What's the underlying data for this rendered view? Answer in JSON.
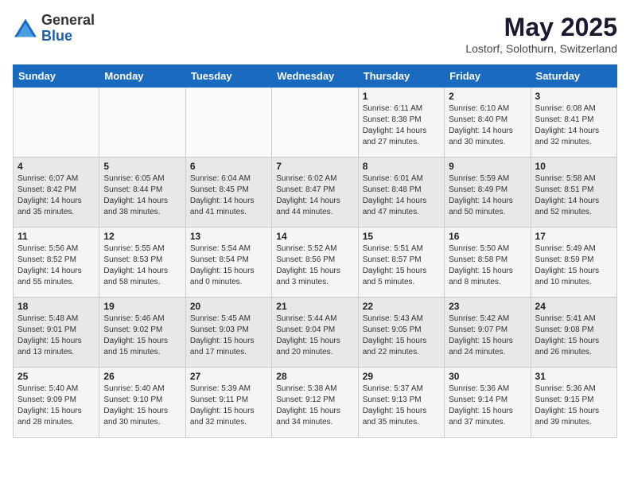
{
  "logo": {
    "general": "General",
    "blue": "Blue"
  },
  "title": "May 2025",
  "subtitle": "Lostorf, Solothurn, Switzerland",
  "days_header": [
    "Sunday",
    "Monday",
    "Tuesday",
    "Wednesday",
    "Thursday",
    "Friday",
    "Saturday"
  ],
  "weeks": [
    [
      {
        "day": "",
        "info": ""
      },
      {
        "day": "",
        "info": ""
      },
      {
        "day": "",
        "info": ""
      },
      {
        "day": "",
        "info": ""
      },
      {
        "day": "1",
        "info": "Sunrise: 6:11 AM\nSunset: 8:38 PM\nDaylight: 14 hours and 27 minutes."
      },
      {
        "day": "2",
        "info": "Sunrise: 6:10 AM\nSunset: 8:40 PM\nDaylight: 14 hours and 30 minutes."
      },
      {
        "day": "3",
        "info": "Sunrise: 6:08 AM\nSunset: 8:41 PM\nDaylight: 14 hours and 32 minutes."
      }
    ],
    [
      {
        "day": "4",
        "info": "Sunrise: 6:07 AM\nSunset: 8:42 PM\nDaylight: 14 hours and 35 minutes."
      },
      {
        "day": "5",
        "info": "Sunrise: 6:05 AM\nSunset: 8:44 PM\nDaylight: 14 hours and 38 minutes."
      },
      {
        "day": "6",
        "info": "Sunrise: 6:04 AM\nSunset: 8:45 PM\nDaylight: 14 hours and 41 minutes."
      },
      {
        "day": "7",
        "info": "Sunrise: 6:02 AM\nSunset: 8:47 PM\nDaylight: 14 hours and 44 minutes."
      },
      {
        "day": "8",
        "info": "Sunrise: 6:01 AM\nSunset: 8:48 PM\nDaylight: 14 hours and 47 minutes."
      },
      {
        "day": "9",
        "info": "Sunrise: 5:59 AM\nSunset: 8:49 PM\nDaylight: 14 hours and 50 minutes."
      },
      {
        "day": "10",
        "info": "Sunrise: 5:58 AM\nSunset: 8:51 PM\nDaylight: 14 hours and 52 minutes."
      }
    ],
    [
      {
        "day": "11",
        "info": "Sunrise: 5:56 AM\nSunset: 8:52 PM\nDaylight: 14 hours and 55 minutes."
      },
      {
        "day": "12",
        "info": "Sunrise: 5:55 AM\nSunset: 8:53 PM\nDaylight: 14 hours and 58 minutes."
      },
      {
        "day": "13",
        "info": "Sunrise: 5:54 AM\nSunset: 8:54 PM\nDaylight: 15 hours and 0 minutes."
      },
      {
        "day": "14",
        "info": "Sunrise: 5:52 AM\nSunset: 8:56 PM\nDaylight: 15 hours and 3 minutes."
      },
      {
        "day": "15",
        "info": "Sunrise: 5:51 AM\nSunset: 8:57 PM\nDaylight: 15 hours and 5 minutes."
      },
      {
        "day": "16",
        "info": "Sunrise: 5:50 AM\nSunset: 8:58 PM\nDaylight: 15 hours and 8 minutes."
      },
      {
        "day": "17",
        "info": "Sunrise: 5:49 AM\nSunset: 8:59 PM\nDaylight: 15 hours and 10 minutes."
      }
    ],
    [
      {
        "day": "18",
        "info": "Sunrise: 5:48 AM\nSunset: 9:01 PM\nDaylight: 15 hours and 13 minutes."
      },
      {
        "day": "19",
        "info": "Sunrise: 5:46 AM\nSunset: 9:02 PM\nDaylight: 15 hours and 15 minutes."
      },
      {
        "day": "20",
        "info": "Sunrise: 5:45 AM\nSunset: 9:03 PM\nDaylight: 15 hours and 17 minutes."
      },
      {
        "day": "21",
        "info": "Sunrise: 5:44 AM\nSunset: 9:04 PM\nDaylight: 15 hours and 20 minutes."
      },
      {
        "day": "22",
        "info": "Sunrise: 5:43 AM\nSunset: 9:05 PM\nDaylight: 15 hours and 22 minutes."
      },
      {
        "day": "23",
        "info": "Sunrise: 5:42 AM\nSunset: 9:07 PM\nDaylight: 15 hours and 24 minutes."
      },
      {
        "day": "24",
        "info": "Sunrise: 5:41 AM\nSunset: 9:08 PM\nDaylight: 15 hours and 26 minutes."
      }
    ],
    [
      {
        "day": "25",
        "info": "Sunrise: 5:40 AM\nSunset: 9:09 PM\nDaylight: 15 hours and 28 minutes."
      },
      {
        "day": "26",
        "info": "Sunrise: 5:40 AM\nSunset: 9:10 PM\nDaylight: 15 hours and 30 minutes."
      },
      {
        "day": "27",
        "info": "Sunrise: 5:39 AM\nSunset: 9:11 PM\nDaylight: 15 hours and 32 minutes."
      },
      {
        "day": "28",
        "info": "Sunrise: 5:38 AM\nSunset: 9:12 PM\nDaylight: 15 hours and 34 minutes."
      },
      {
        "day": "29",
        "info": "Sunrise: 5:37 AM\nSunset: 9:13 PM\nDaylight: 15 hours and 35 minutes."
      },
      {
        "day": "30",
        "info": "Sunrise: 5:36 AM\nSunset: 9:14 PM\nDaylight: 15 hours and 37 minutes."
      },
      {
        "day": "31",
        "info": "Sunrise: 5:36 AM\nSunset: 9:15 PM\nDaylight: 15 hours and 39 minutes."
      }
    ]
  ]
}
